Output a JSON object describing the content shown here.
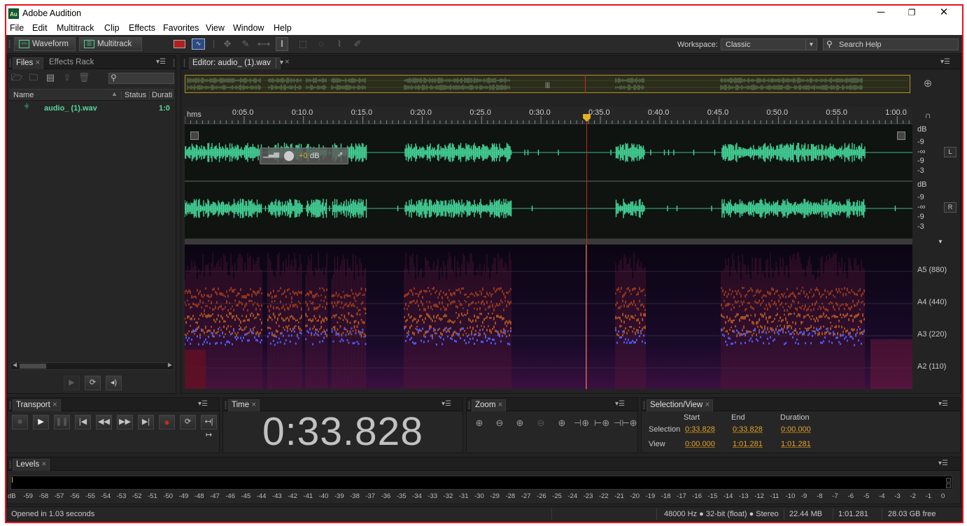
{
  "window": {
    "title": "Adobe Audition",
    "app_icon": "Au",
    "minimize": "─",
    "restore": "❐",
    "close": "✕"
  },
  "menu": [
    "File",
    "Edit",
    "Multitrack",
    "Clip",
    "Effects",
    "Favorites",
    "View",
    "Window",
    "Help"
  ],
  "toolbar": {
    "waveform_label": "Waveform",
    "multitrack_label": "Multitrack",
    "workspace_label": "Workspace:",
    "workspace_value": "Classic",
    "search_placeholder": "Search Help"
  },
  "files_panel": {
    "tabs": [
      "Files",
      "Effects Rack"
    ],
    "columns": [
      "Name",
      "Status",
      "Durati"
    ],
    "files": [
      {
        "name": "audio_ (1).wav",
        "duration": "1:0"
      }
    ]
  },
  "editor": {
    "tab_label": "Editor: audio_ (1).wav",
    "ruler_unit": "hms",
    "ruler_ticks": [
      "0:05.0",
      "0:10.0",
      "0:15.0",
      "0:20.0",
      "0:25.0",
      "0:30.0",
      "0:35.0",
      "0:40.0",
      "0:45.0",
      "0:50.0",
      "0:55.0",
      "1:00.0"
    ],
    "playhead_seconds": 33.828,
    "total_seconds": 61.281,
    "hud_gain": "+0",
    "hud_unit": "dB",
    "db_scale": [
      "dB",
      "-9",
      "-∞",
      "-9",
      "-3"
    ],
    "channels": [
      "L",
      "R"
    ],
    "spectral_labels": [
      "A5 (880)",
      "A4 (440)",
      "A3 (220)",
      "A2 (110)"
    ]
  },
  "transport": {
    "tab": "Transport"
  },
  "time": {
    "tab": "Time",
    "value": "0:33.828"
  },
  "zoom": {
    "tab": "Zoom"
  },
  "selection": {
    "tab": "Selection/View",
    "headers": [
      "Start",
      "End",
      "Duration"
    ],
    "rows": [
      {
        "label": "Selection",
        "start": "0:33.828",
        "end": "0:33.828",
        "duration": "0:00.000"
      },
      {
        "label": "View",
        "start": "0:00.000",
        "end": "1:01.281",
        "duration": "1:01.281"
      }
    ]
  },
  "levels": {
    "tab": "Levels",
    "scale": [
      "dB",
      "-59",
      "-58",
      "-57",
      "-56",
      "-55",
      "-54",
      "-53",
      "-52",
      "-51",
      "-50",
      "-49",
      "-48",
      "-47",
      "-46",
      "-45",
      "-44",
      "-43",
      "-42",
      "-41",
      "-40",
      "-39",
      "-38",
      "-37",
      "-36",
      "-35",
      "-34",
      "-33",
      "-32",
      "-31",
      "-30",
      "-29",
      "-28",
      "-27",
      "-26",
      "-25",
      "-24",
      "-23",
      "-22",
      "-21",
      "-20",
      "-19",
      "-18",
      "-17",
      "-16",
      "-15",
      "-14",
      "-13",
      "-12",
      "-11",
      "-10",
      "-9",
      "-8",
      "-7",
      "-6",
      "-5",
      "-4",
      "-3",
      "-2",
      "-1",
      "0"
    ]
  },
  "status": {
    "message": "Opened in 1.03 seconds",
    "format": "48000 Hz ● 32-bit (float) ● Stereo",
    "size": "22.44 MB",
    "duration": "1:01.281",
    "free": "28.03 GB free"
  },
  "colors": {
    "waveform": "#45d69a",
    "playhead": "#d02a20",
    "accent": "#e4a42c",
    "spectral_blue": "#4a5cff"
  }
}
